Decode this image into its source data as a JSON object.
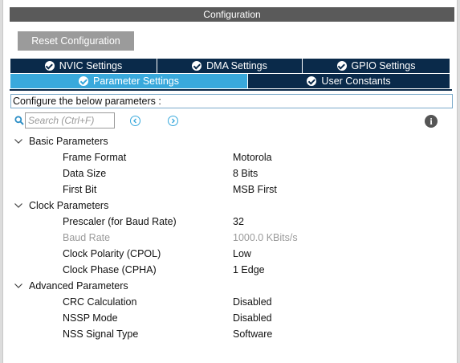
{
  "window": {
    "title": "Configuration"
  },
  "toolbar": {
    "reset_label": "Reset Configuration"
  },
  "tabs_row1": [
    {
      "label": "NVIC Settings",
      "icon": "check-circle-icon"
    },
    {
      "label": "DMA Settings",
      "icon": "check-circle-icon"
    },
    {
      "label": "GPIO Settings",
      "icon": "check-circle-icon"
    }
  ],
  "tabs_row2": [
    {
      "label": "Parameter Settings",
      "icon": "check-circle-icon",
      "active": true
    },
    {
      "label": "User Constants",
      "icon": "check-circle-icon",
      "active": false
    }
  ],
  "main": {
    "configure_text": "Configure the below parameters :",
    "search": {
      "placeholder": "Search (Ctrl+F)",
      "value": ""
    }
  },
  "groups": [
    {
      "label": "Basic Parameters",
      "expanded": true,
      "params": [
        {
          "name": "Frame Format",
          "value": "Motorola",
          "enabled": true
        },
        {
          "name": "Data Size",
          "value": "8 Bits",
          "enabled": true
        },
        {
          "name": "First Bit",
          "value": "MSB First",
          "enabled": true
        }
      ]
    },
    {
      "label": "Clock Parameters",
      "expanded": true,
      "params": [
        {
          "name": "Prescaler (for Baud Rate)",
          "value": "32",
          "enabled": true
        },
        {
          "name": "Baud Rate",
          "value": "1000.0 KBits/s",
          "enabled": false
        },
        {
          "name": "Clock Polarity (CPOL)",
          "value": "Low",
          "enabled": true
        },
        {
          "name": "Clock Phase (CPHA)",
          "value": "1 Edge",
          "enabled": true
        }
      ]
    },
    {
      "label": "Advanced Parameters",
      "expanded": true,
      "params": [
        {
          "name": "CRC Calculation",
          "value": "Disabled",
          "enabled": true
        },
        {
          "name": "NSSP Mode",
          "value": "Disabled",
          "enabled": true
        },
        {
          "name": "NSS Signal Type",
          "value": "Software",
          "enabled": true
        }
      ]
    }
  ],
  "colors": {
    "accent": "#39a9dc",
    "tab_dark": "#0a2a4a",
    "title_bar": "#5a5a5a",
    "button": "#9b9b9b"
  }
}
